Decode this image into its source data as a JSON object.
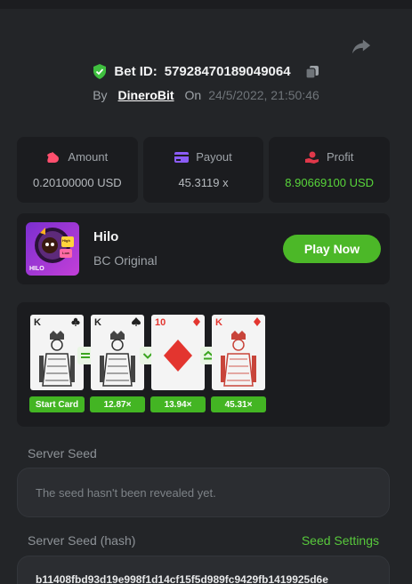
{
  "header": {
    "bet_id_label": "Bet ID:",
    "bet_id": "57928470189049064",
    "by_label": "By",
    "username": "DineroBit",
    "on_label": "On",
    "datetime": "24/5/2022, 21:50:46"
  },
  "stats": [
    {
      "label": "Amount",
      "value": "0.20100000 USD",
      "icon": "money-bag-icon",
      "color": "#ff4f6e"
    },
    {
      "label": "Payout",
      "value": "45.3119 x",
      "icon": "card-icon",
      "color": "#8b5cf6"
    },
    {
      "label": "Profit",
      "value": "8.90669100 USD",
      "icon": "hand-coin-icon",
      "color": "#e0384a"
    }
  ],
  "game": {
    "title": "Hilo",
    "subtitle": "BC Original",
    "play_label": "Play Now",
    "thumb_text": "HILO",
    "thumb_tag_top": "High",
    "thumb_tag_bottom": "Low"
  },
  "cards": [
    {
      "rank": "K",
      "suit": "clubs",
      "multiplier": "Start Card",
      "color": "#222222"
    },
    {
      "rank": "K",
      "suit": "spades",
      "multiplier": "12.87×",
      "color": "#222222"
    },
    {
      "rank": "10",
      "suit": "diamonds",
      "multiplier": "13.94×",
      "color": "#e3352f"
    },
    {
      "rank": "K",
      "suit": "diamonds",
      "multiplier": "45.31×",
      "color": "#e3352f"
    }
  ],
  "arrows": [
    "equal",
    "lower",
    "higher-or-equal"
  ],
  "seeds": {
    "server_seed_label": "Server Seed",
    "server_seed_value": "The seed hasn't been revealed yet.",
    "server_hash_label": "Server Seed (hash)",
    "seed_settings_label": "Seed Settings",
    "server_hash_value": "b11408fbd93d19e998f1d14cf15f5d989fc9429fb1419925d6e"
  },
  "colors": {
    "accent_green": "#4cb828",
    "profit_green": "#58d53a",
    "background": "#232528",
    "panel": "#1b1c1f"
  }
}
